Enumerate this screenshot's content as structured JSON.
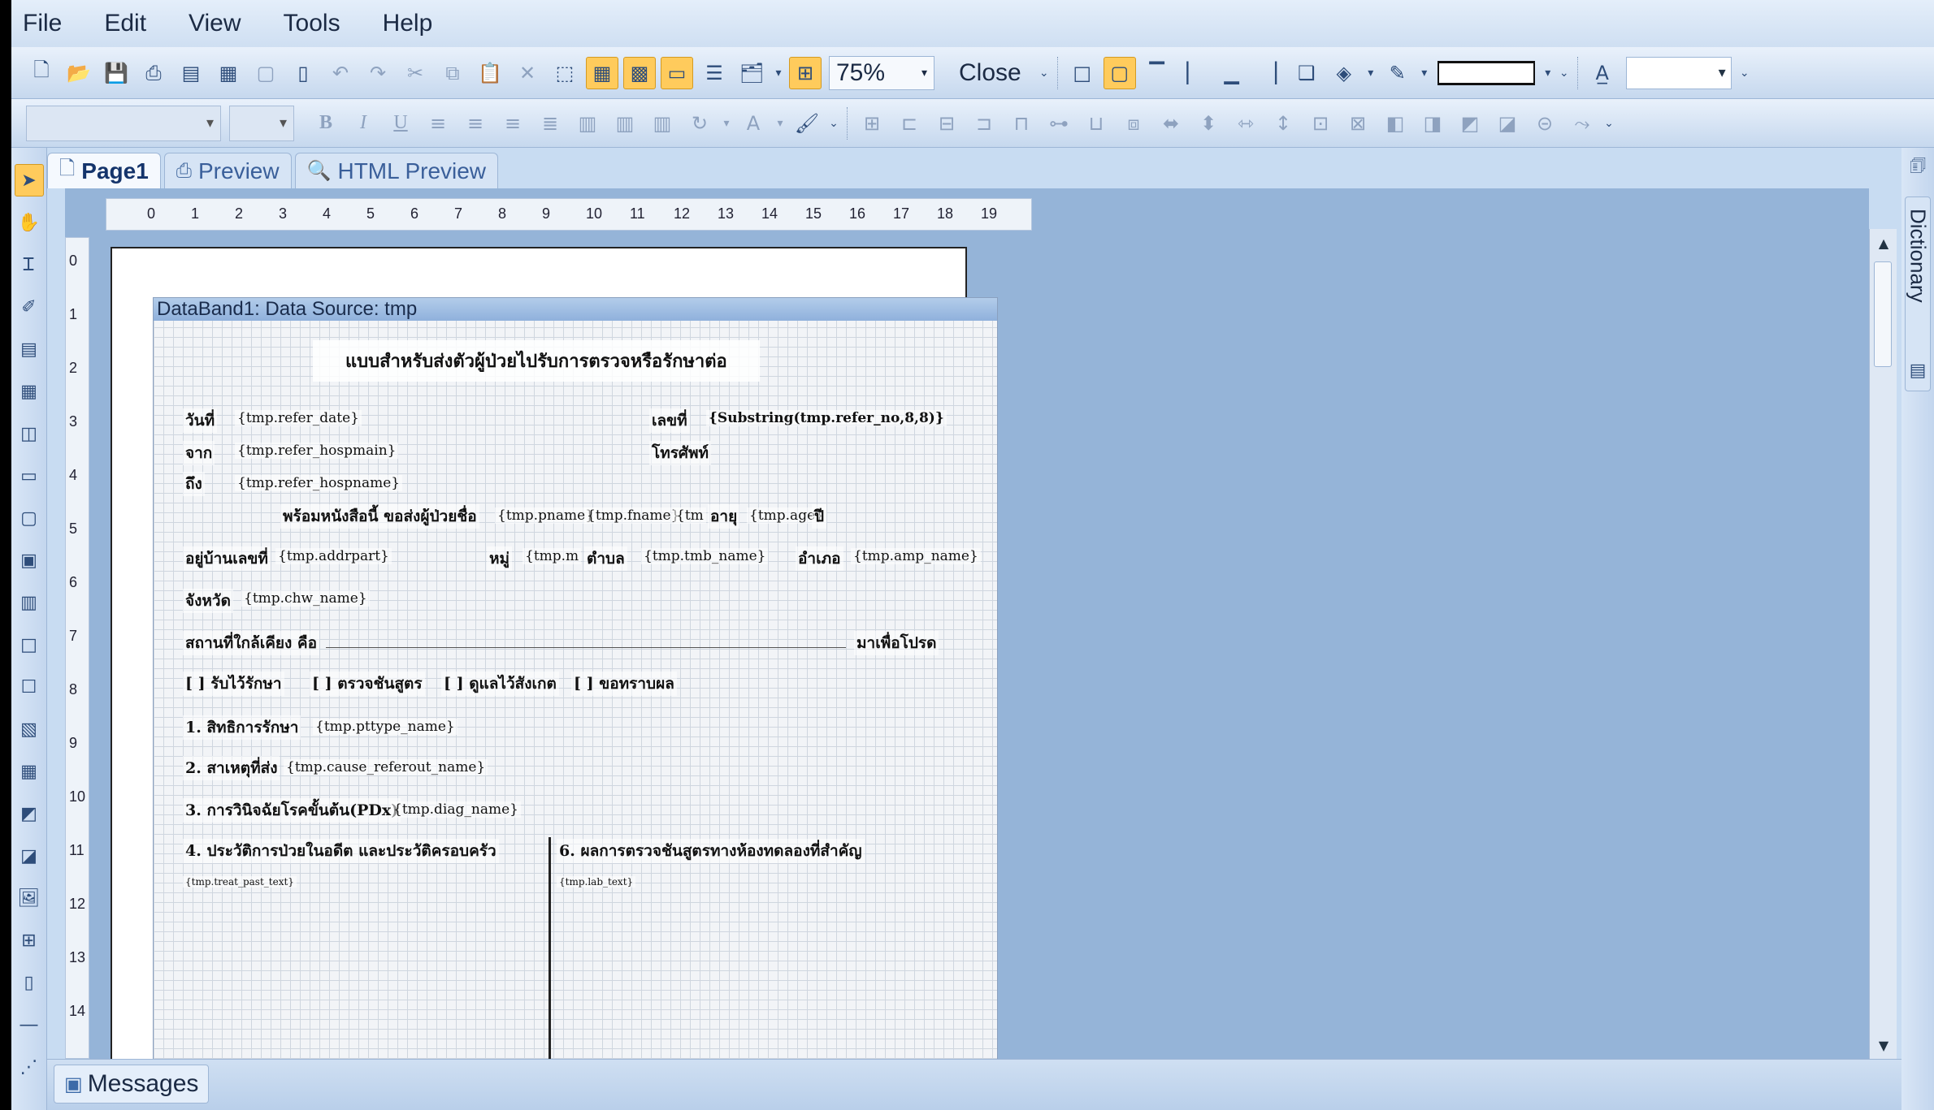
{
  "menu": [
    "File",
    "Edit",
    "View",
    "Tools",
    "Help"
  ],
  "toolbar": {
    "zoom": "75%",
    "close_label": "Close"
  },
  "tabs": [
    {
      "label": "Page1",
      "active": true
    },
    {
      "label": "Preview",
      "active": false
    },
    {
      "label": "HTML Preview",
      "active": false
    }
  ],
  "ruler": {
    "h": [
      "0",
      "1",
      "2",
      "3",
      "4",
      "5",
      "6",
      "7",
      "8",
      "9",
      "10",
      "11",
      "12",
      "13",
      "14",
      "15",
      "16",
      "17",
      "18",
      "19"
    ],
    "v": [
      "0",
      "1",
      "2",
      "3",
      "4",
      "5",
      "6",
      "7",
      "8",
      "9",
      "10",
      "11",
      "12",
      "13",
      "14"
    ]
  },
  "band": {
    "header": "DataBand1: Data Source: tmp"
  },
  "report": {
    "title": "แบบสำหรับส่งตัวผู้ป่วยไปรับการตรวจหรือรักษาต่อ",
    "date_label": "วันที่",
    "date_field": "{tmp.refer_date}",
    "no_label": "เลขที่",
    "no_field": "{Substring(tmp.refer_no,8,8)}",
    "from_label": "จาก",
    "from_field": "{tmp.refer_hospmain}",
    "phone_label": "โทรศัพท์",
    "to_label": "ถึง",
    "to_field": "{tmp.refer_hospname}",
    "with_label": "พร้อมหนังสือนี้ ขอส่งผู้ป่วยชื่อ",
    "pname_field": "{tmp.pname}",
    "fname_field": "{tmp.fname}",
    "lname_field": "{tm",
    "age_label": "อายุ",
    "age_field": "{tmp.age}",
    "year_label": "ปี",
    "addr_label": "อยู่บ้านเลขที่",
    "addr_field": "{tmp.addrpart}",
    "moo_label": "หมู่",
    "moo_field": "{tmp.m",
    "tambon_label": "ตำบล",
    "tambon_field": "{tmp.tmb_name}",
    "amphur_label": "อำเภอ",
    "amphur_field": "{tmp.amp_name}",
    "province_label": "จังหวัด",
    "province_field": "{tmp.chw_name}",
    "nearby_label": "สถานที่ใกล้เคียง คือ",
    "please_label": "มาเพื่อโปรด",
    "opt1": "[ ] รับไว้รักษา",
    "opt2": "[ ] ตรวจชันสูตร",
    "opt3": "[ ] ดูแลไว้สังเกต",
    "opt4": "[ ] ขอทราบผล",
    "s1_label": "1. สิทธิการรักษา",
    "s1_field": "{tmp.pttype_name}",
    "s2_label": "2. สาเหตุที่ส่ง",
    "s2_field": "{tmp.cause_referout_name}",
    "s3_label": "3. การวินิจฉัยโรคขั้นต้น(PDx)",
    "s3_field": "{tmp.diag_name}",
    "s4_label": "4. ประวัติการป่วยในอดีต และประวัติครอบครัว",
    "s4_field": "{tmp.treat_past_text}",
    "s6_label": "6. ผลการตรวจชันสูตรทางห้องทดลองที่สำคัญ",
    "s6_field": "{tmp.lab_text}"
  },
  "right_panel": {
    "dictionary_label": "Dictionary"
  },
  "status": {
    "messages_label": "Messages"
  },
  "colors": {
    "accent": "#ffcb5c",
    "band_header": "#8fb1dc",
    "workspace": "#95b4d8"
  }
}
